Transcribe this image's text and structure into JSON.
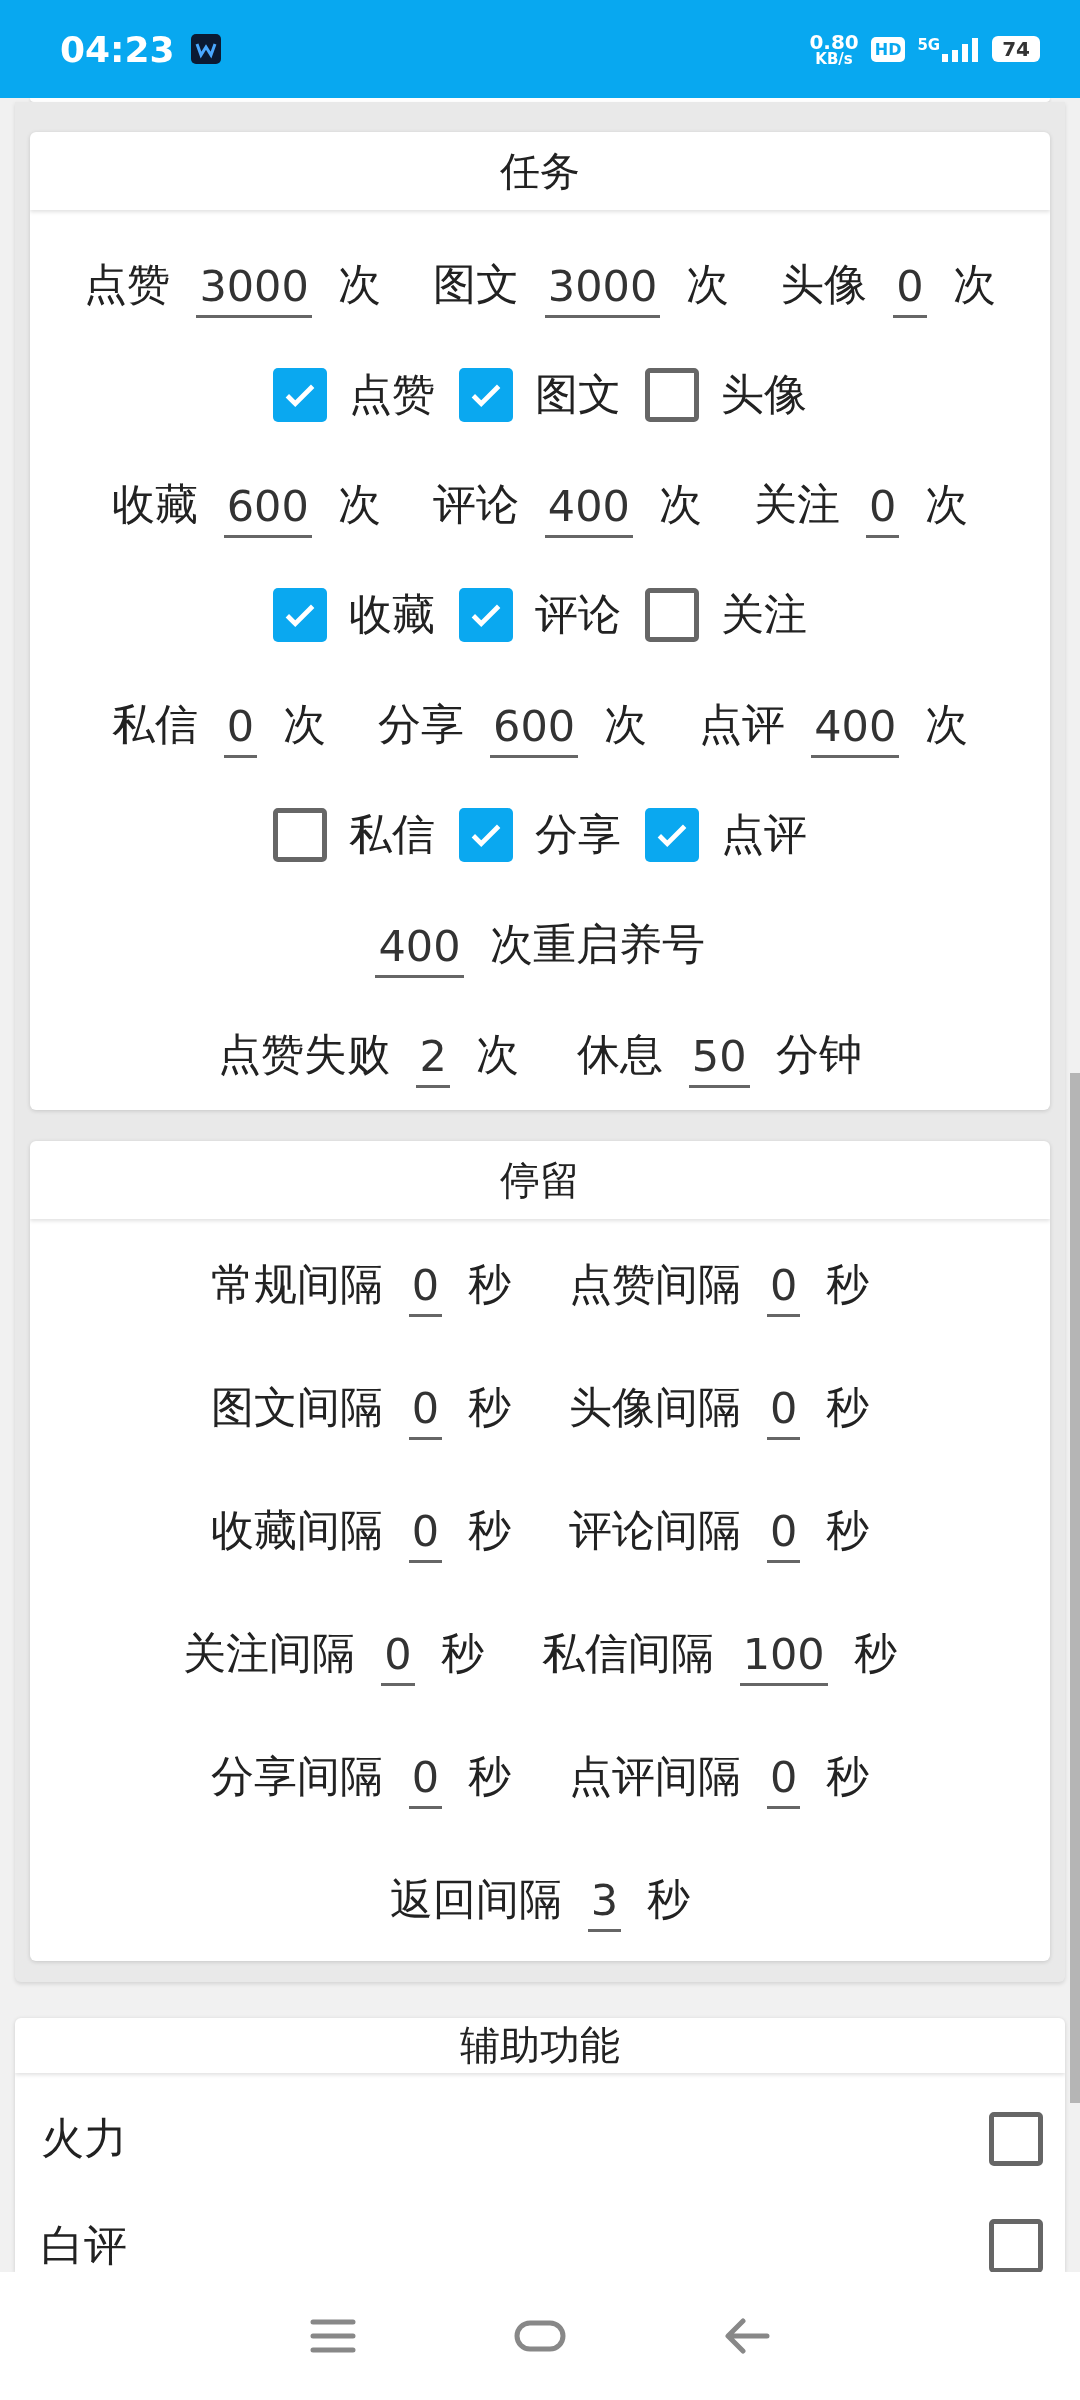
{
  "status_bar": {
    "time": "04:23",
    "net_speed": "0.80",
    "net_unit": "KB/s",
    "hd": "HD",
    "network": "5G",
    "battery": "74"
  },
  "sections": [
    {
      "kind": "inset",
      "title": "任务",
      "rows": [
        {
          "kind": "fields",
          "items": [
            {
              "label": "点赞",
              "value": "3000",
              "unit": "次"
            },
            {
              "label": "图文",
              "value": "3000",
              "unit": "次"
            },
            {
              "label": "头像",
              "value": "0",
              "unit": "次"
            }
          ]
        },
        {
          "kind": "checks",
          "items": [
            {
              "label": "点赞",
              "checked": true
            },
            {
              "label": "图文",
              "checked": true
            },
            {
              "label": "头像",
              "checked": false
            }
          ]
        },
        {
          "kind": "fields",
          "items": [
            {
              "label": "收藏",
              "value": "600",
              "unit": "次"
            },
            {
              "label": "评论",
              "value": "400",
              "unit": "次"
            },
            {
              "label": "关注",
              "value": "0",
              "unit": "次"
            }
          ]
        },
        {
          "kind": "checks",
          "items": [
            {
              "label": "收藏",
              "checked": true
            },
            {
              "label": "评论",
              "checked": true
            },
            {
              "label": "关注",
              "checked": false
            }
          ]
        },
        {
          "kind": "fields",
          "items": [
            {
              "label": "私信",
              "value": "0",
              "unit": "次"
            },
            {
              "label": "分享",
              "value": "600",
              "unit": "次"
            },
            {
              "label": "点评",
              "value": "400",
              "unit": "次"
            }
          ]
        },
        {
          "kind": "checks",
          "items": [
            {
              "label": "私信",
              "checked": false
            },
            {
              "label": "分享",
              "checked": true
            },
            {
              "label": "点评",
              "checked": true
            }
          ]
        },
        {
          "kind": "fields",
          "items": [
            {
              "value": "400",
              "unit": "次重启养号"
            }
          ]
        },
        {
          "kind": "fields",
          "items": [
            {
              "label": "点赞失败",
              "value": "2",
              "unit": "次"
            },
            {
              "label": "休息",
              "value": "50",
              "unit": "分钟"
            }
          ]
        }
      ]
    },
    {
      "kind": "inset",
      "title": "停留",
      "rows": [
        {
          "kind": "fields",
          "items": [
            {
              "label": "常规间隔",
              "value": "0",
              "unit": "秒"
            },
            {
              "label": "点赞间隔",
              "value": "0",
              "unit": "秒"
            }
          ]
        },
        {
          "kind": "fields",
          "items": [
            {
              "label": "图文间隔",
              "value": "0",
              "unit": "秒"
            },
            {
              "label": "头像间隔",
              "value": "0",
              "unit": "秒"
            }
          ]
        },
        {
          "kind": "fields",
          "items": [
            {
              "label": "收藏间隔",
              "value": "0",
              "unit": "秒"
            },
            {
              "label": "评论间隔",
              "value": "0",
              "unit": "秒"
            }
          ]
        },
        {
          "kind": "fields",
          "items": [
            {
              "label": "关注间隔",
              "value": "0",
              "unit": "秒"
            },
            {
              "label": "私信间隔",
              "value": "100",
              "unit": "秒"
            }
          ]
        },
        {
          "kind": "fields",
          "items": [
            {
              "label": "分享间隔",
              "value": "0",
              "unit": "秒"
            },
            {
              "label": "点评间隔",
              "value": "0",
              "unit": "秒"
            }
          ]
        },
        {
          "kind": "fields",
          "items": [
            {
              "label": "返回间隔",
              "value": "3",
              "unit": "秒"
            }
          ]
        }
      ]
    },
    {
      "kind": "full",
      "title": "辅助功能",
      "rows": [
        {
          "kind": "toggle",
          "label": "火力",
          "checked": false
        },
        {
          "kind": "toggle",
          "label": "白评",
          "checked": false
        }
      ]
    }
  ]
}
